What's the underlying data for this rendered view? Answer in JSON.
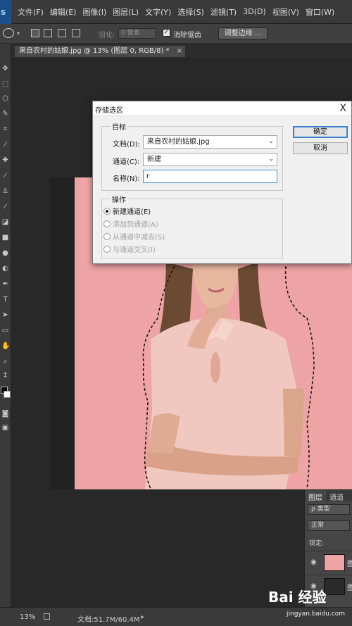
{
  "app": {
    "logo": "s",
    "menu": [
      "文件(F)",
      "编辑(E)",
      "图像(I)",
      "图层(L)",
      "文字(Y)",
      "选择(S)",
      "滤镜(T)",
      "3D(D)",
      "视图(V)",
      "窗口(W)"
    ]
  },
  "options": {
    "feather_label": "羽化:",
    "feather_value": "0 像素",
    "antialias_label": "消除锯齿",
    "refine_edge_button": "调整边缘 ..."
  },
  "document_tab": {
    "title": "来自农村的姑娘.jpg @ 13% (图层 0, RGB/8) *",
    "close": "×"
  },
  "dialog": {
    "title": "存储选区",
    "close": "X",
    "destination_group": "目标",
    "document_label": "文档(D):",
    "document_value": "来自农村的姑娘.jpg",
    "channel_label": "通道(C):",
    "channel_value": "新建",
    "name_label": "名称(N):",
    "name_value": "r",
    "operation_group": "操作",
    "operations": [
      {
        "label": "新建通道(E)",
        "selected": true,
        "enabled": true
      },
      {
        "label": "添加到通道(A)",
        "selected": false,
        "enabled": false
      },
      {
        "label": "从通道中减去(S)",
        "selected": false,
        "enabled": false
      },
      {
        "label": "与通道交叉(I)",
        "selected": false,
        "enabled": false
      }
    ],
    "ok_button": "确定",
    "cancel_button": "取消"
  },
  "layers_panel": {
    "tabs": [
      "图层",
      "通道"
    ],
    "kind_filter": "ρ 类型",
    "blend_mode": "正常",
    "lock_label": "锁定:",
    "layer_names": [
      "图",
      "图"
    ]
  },
  "status": {
    "zoom": "13%",
    "doc_info": "文档:51.7M/60.4M"
  },
  "watermark": {
    "brand": "Bai 经验",
    "url": "jingyan.baidu.com"
  },
  "colors": {
    "photo_background": "#eea3a5",
    "dialog_accent": "#3c7fcf",
    "foreground_swatch": "#000000",
    "background_swatch": "#ffffff"
  }
}
